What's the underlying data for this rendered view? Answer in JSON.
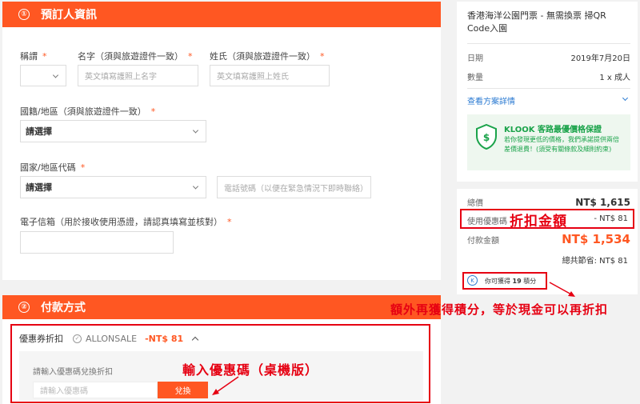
{
  "booker": {
    "number": "①",
    "title": "預訂人資訊",
    "salutation_label": "稱謂",
    "first_name_label": "名字（須與旅遊證件一致）",
    "first_name_placeholder": "英文填寫護照上名字",
    "last_name_label": "姓氏（須與旅遊證件一致）",
    "last_name_placeholder": "英文填寫護照上姓氏",
    "nationality_label": "國籍/地區（須與旅遊證件一致）",
    "nationality_value": "請選擇",
    "country_code_label": "國家/地區代碼",
    "country_code_value": "請選擇",
    "phone_placeholder": "電話號碼（以便在緊急情況下即時聯絡）",
    "email_label": "電子信箱（用於接收使用憑證，請認真填寫並核對）",
    "required_mark": "*"
  },
  "payment": {
    "number": "②",
    "title": "付款方式",
    "coupon_label": "優惠券折扣",
    "coupon_code": "ALLONSALE",
    "coupon_amount": "-NT$ 81",
    "promo_hint": "請輸入優惠碼兌換折扣",
    "promo_placeholder": "請輸入優惠碼",
    "redeem_label": "兌換"
  },
  "summary": {
    "product_title": "香港海洋公園門票 - 無需換票 掃QR Code入園",
    "date_label": "日期",
    "date_value": "2019年7月20日",
    "qty_label": "數量",
    "qty_value": "1 x 成人",
    "details_link": "查看方案詳情",
    "guarantee_title": "KLOOK 客路最優價格保證",
    "guarantee_text": "若你發現更低的價格，我們承諾提供兩倍差價退費！(須受有關條款及細則約束)"
  },
  "totals": {
    "total_label": "總價",
    "total_value": "NT$ 1,615",
    "discount_label": "使用優惠碼",
    "discount_value": "- NT$ 81",
    "pay_label": "付款金額",
    "pay_value": "NT$ 1,534",
    "saved_text": "總共節省: NT$ 81",
    "points_prefix": "你可獲得",
    "points_value": "19",
    "points_suffix": "積分"
  },
  "annotations": {
    "discount_note": "折扣金額",
    "points_note": "額外再獲得積分，等於現金可以再折扣",
    "promo_note": "輸入優惠碼（桌機版）"
  },
  "colors": {
    "accent": "#ff5722",
    "annotation_red": "#e60012",
    "green": "#1aa34a"
  }
}
